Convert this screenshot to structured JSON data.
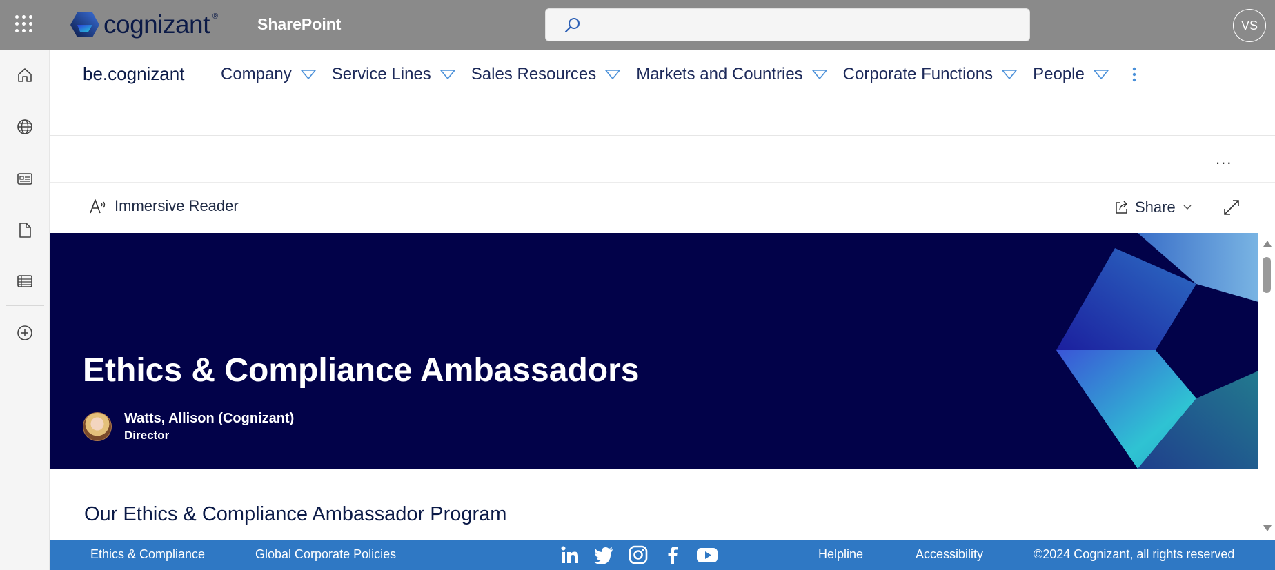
{
  "suite_bar": {
    "brand": "cognizant",
    "brand_mark": "®",
    "app_name": "SharePoint",
    "search_placeholder": "",
    "user_initials": "VS",
    "bg_color": "#8a8a8a"
  },
  "app_bar": {
    "items": [
      {
        "name": "home-icon"
      },
      {
        "name": "globe-icon"
      },
      {
        "name": "news-icon"
      },
      {
        "name": "document-icon"
      },
      {
        "name": "lists-icon"
      },
      {
        "name": "add-icon"
      }
    ]
  },
  "site_header": {
    "title": "be.cognizant",
    "nav": [
      {
        "label": "Company"
      },
      {
        "label": "Service Lines"
      },
      {
        "label": "Sales Resources"
      },
      {
        "label": "Markets and Countries"
      },
      {
        "label": "Corporate Functions"
      },
      {
        "label": "People"
      }
    ]
  },
  "command_bar": {
    "more": "..."
  },
  "reader_bar": {
    "immersive_reader": "Immersive Reader",
    "share": "Share"
  },
  "hero": {
    "title": "Ethics & Compliance Ambassadors",
    "author_name": "Watts, Allison (Cognizant)",
    "author_role": "Director",
    "bg_color": "#020249"
  },
  "content": {
    "section_heading": "Our Ethics & Compliance Ambassador Program"
  },
  "footer": {
    "left_links": [
      "Ethics & Compliance",
      "Global Corporate Policies"
    ],
    "social": [
      "linkedin-icon",
      "twitter-icon",
      "instagram-icon",
      "facebook-icon",
      "youtube-icon"
    ],
    "right_links": [
      "Helpline",
      "Accessibility"
    ],
    "copyright": "©2024 Cognizant, all rights reserved",
    "bg_color": "#2f78c4"
  }
}
